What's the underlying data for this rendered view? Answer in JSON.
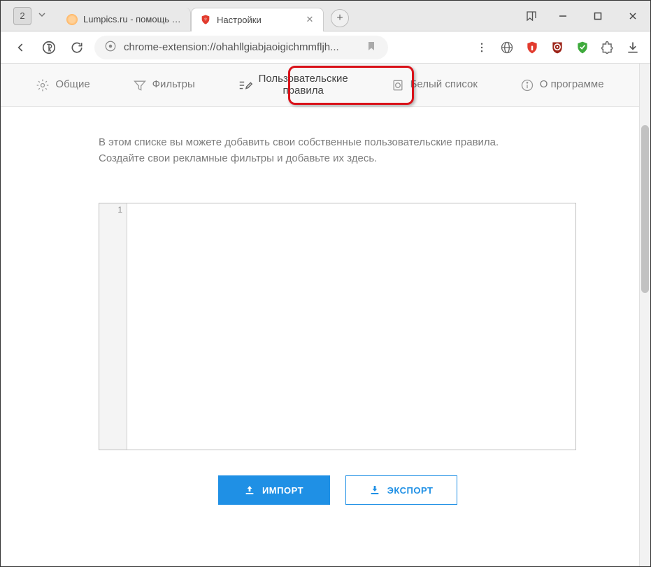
{
  "browser": {
    "tab_count": "2",
    "tabs": [
      {
        "title": "Lumpics.ru - помощь с ком"
      },
      {
        "title": "Настройки"
      }
    ],
    "url": "chrome-extension://ohahllgiabjaoigichmmfljh..."
  },
  "nav": {
    "general": "Общие",
    "filters": "Фильтры",
    "user_rules_line1": "Пользовательские",
    "user_rules_line2": "правила",
    "whitelist": "Белый список",
    "about": "О программе"
  },
  "description": "В этом списке вы можете добавить свои собственные пользовательские правила. Создайте свои рекламные фильтры и добавьте их здесь.",
  "editor": {
    "line_number": "1"
  },
  "buttons": {
    "import": "ИМПОРТ",
    "export": "ЭКСПОРТ"
  }
}
